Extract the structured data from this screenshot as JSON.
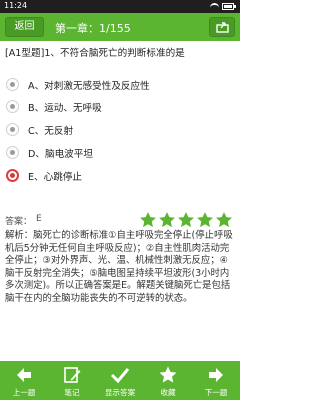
{
  "status_bar": {
    "time": "11:24"
  },
  "header": {
    "back_label": "返回",
    "title": "第一章：1/155"
  },
  "question": {
    "text": "[A1型题]1、不符合脑死亡的判断标准的是"
  },
  "options": [
    {
      "label": "A、对刺激无感受性及反应性",
      "state": "normal"
    },
    {
      "label": "B、运动、无呼吸",
      "state": "normal"
    },
    {
      "label": "C、无反射",
      "state": "normal"
    },
    {
      "label": "D、脑电波平坦",
      "state": "normal"
    },
    {
      "label": "E、心跳停止",
      "state": "wrong-selected"
    }
  ],
  "answer": {
    "label": "答案：",
    "value": "E",
    "rating": 5,
    "rating_max": 5
  },
  "analysis": {
    "text": "解析：脑死亡的诊断标准①自主呼吸完全停止(停止呼吸机后5分钟无任何自主呼吸反应)；②自主性肌肉活动完全停止；③对外界声、光、温、机械性刺激无反应；④脑干反射完全消失；⑤脑电图呈持续平坦波形(3小时内多次测定)。所以正确答案是E。解题关键脑死亡是包括脑干在内的全脑功能丧失的不可逆转的状态。"
  },
  "bottom_nav": [
    {
      "label": "上一题",
      "icon": "arrow-left-icon"
    },
    {
      "label": "笔记",
      "icon": "note-icon"
    },
    {
      "label": "显示答案",
      "icon": "check-icon"
    },
    {
      "label": "收藏",
      "icon": "star-icon"
    },
    {
      "label": "下一题",
      "icon": "arrow-right-icon"
    }
  ],
  "colors": {
    "primary_green": "#5cb531",
    "star_green": "#5cb531",
    "wrong_red": "#e23b3b"
  }
}
